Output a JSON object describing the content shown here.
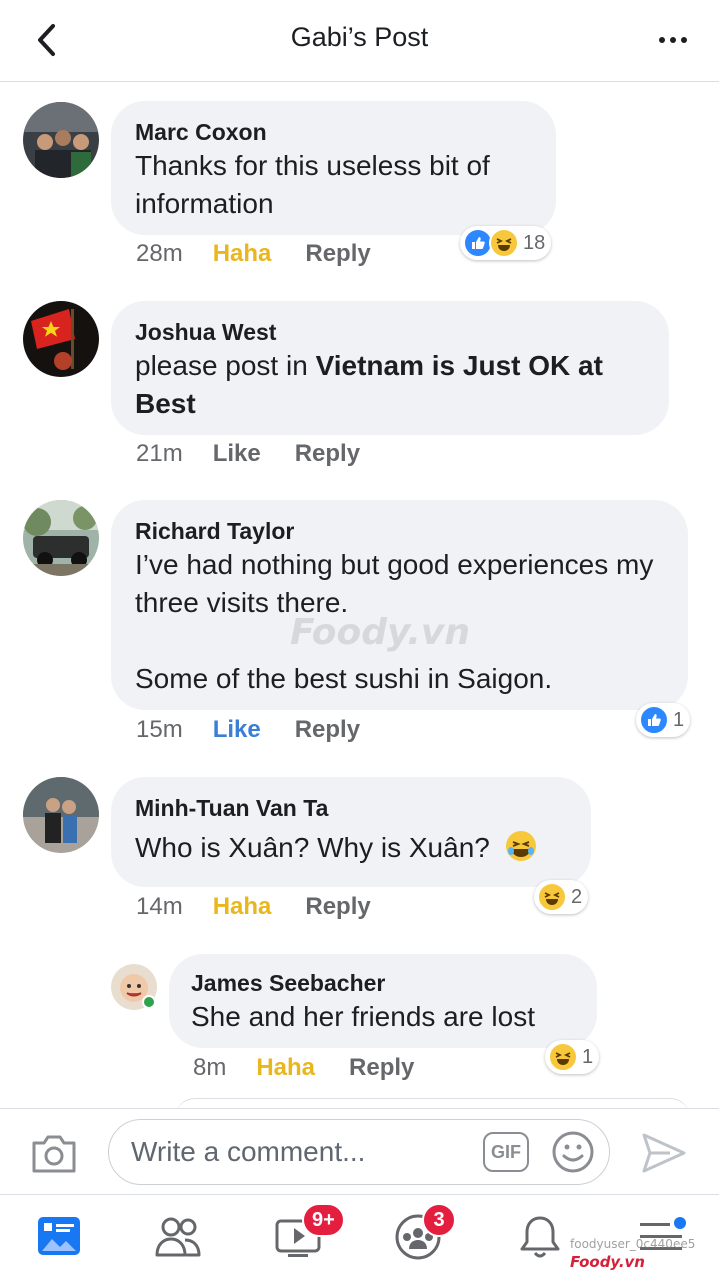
{
  "header": {
    "title": "Gabi’s Post"
  },
  "comments": [
    {
      "name": "Marc Coxon",
      "text": "Thanks for this useless bit of information",
      "time": "28m",
      "action": "Haha",
      "reply": "Reply",
      "reaction_count": "18"
    },
    {
      "name": "Joshua West",
      "text_prefix": "please post in ",
      "text_bold": "Vietnam is Just OK at Best",
      "time": "21m",
      "action": "Like",
      "reply": "Reply"
    },
    {
      "name": "Richard Taylor",
      "text": "I’ve had nothing but good experiences my three visits there.",
      "text2": "Some of the best sushi in Saigon.",
      "time": "15m",
      "action": "Like",
      "reply": "Reply",
      "reaction_count": "1"
    },
    {
      "name": "Minh-Tuan Van Ta",
      "text": "Who is Xuân? Why is Xuân?",
      "time": "14m",
      "action": "Haha",
      "reply": "Reply",
      "reaction_count": "2"
    },
    {
      "name": "James Seebacher",
      "text": "She and her friends are lost",
      "time": "8m",
      "action": "Haha",
      "reply": "Reply",
      "reaction_count": "1"
    }
  ],
  "composer": {
    "placeholder": "Write a comment...",
    "gif_label": "GIF"
  },
  "tabbar": {
    "video_badge": "9+",
    "groups_badge": "3"
  },
  "watermark": {
    "center": "Foody.vn",
    "corner_user": "foodyuser_0c440ee5",
    "corner_logo": "Foody.vn"
  },
  "colors": {
    "haha": "#e9b61d",
    "like_active": "#3b7ed6",
    "bubble": "#f0f2f5",
    "badge": "#e41e3f"
  }
}
